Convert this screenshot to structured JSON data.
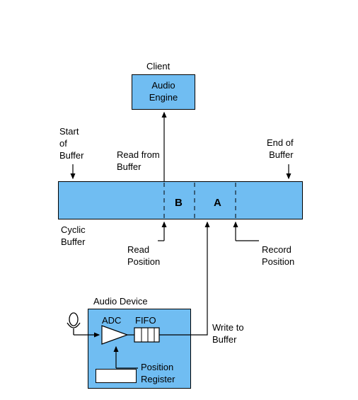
{
  "client": {
    "heading": "Client",
    "box_label": "Audio\nEngine"
  },
  "buffer": {
    "start_label": "Start\nof\nBuffer",
    "end_label": "End of\nBuffer",
    "read_from": "Read from\nBuffer",
    "name": "Cyclic\nBuffer",
    "segment_b": "B",
    "segment_a": "A",
    "read_position": "Read\nPosition",
    "record_position": "Record\nPosition"
  },
  "device": {
    "heading": "Audio Device",
    "adc": "ADC",
    "fifo": "FIFO",
    "position_register": "Position\nRegister",
    "write_to": "Write to\nBuffer"
  },
  "icons": {
    "mic": "microphone-icon"
  }
}
